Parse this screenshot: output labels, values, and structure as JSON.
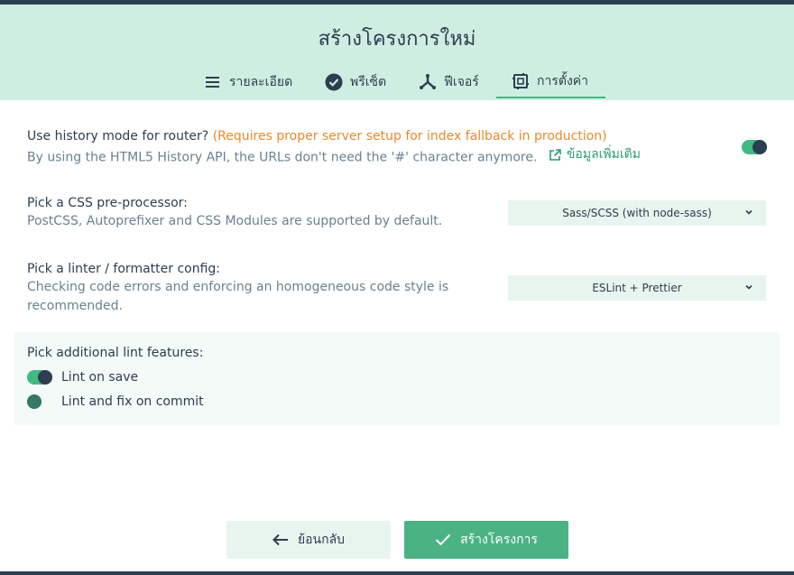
{
  "header": {
    "title": "สร้างโครงการใหม่"
  },
  "tabs": [
    {
      "label": "รายละเอียด",
      "icon": "list-icon"
    },
    {
      "label": "พรีเซ็ต",
      "icon": "check-circle-icon"
    },
    {
      "label": "ฟีเจอร์",
      "icon": "branch-icon"
    },
    {
      "label": "การตั้งค่า",
      "icon": "settings-chip-icon",
      "active": true
    }
  ],
  "history": {
    "label": "Use history mode for router?",
    "warning": "(Requires proper server setup for index fallback in production)",
    "description": "By using the HTML5 History API, the URLs don't need the '#' character anymore.",
    "more_link": "ข้อมูลเพิ่มเติม",
    "enabled": true
  },
  "css": {
    "label": "Pick a CSS pre-processor:",
    "description": "PostCSS, Autoprefixer and CSS Modules are supported by default.",
    "selected": "Sass/SCSS (with node-sass)"
  },
  "linter": {
    "label": "Pick a linter / formatter config:",
    "description_line1": "Checking code errors and enforcing an homogeneous code style is",
    "description_line2": "recommended.",
    "selected": "ESLint + Prettier"
  },
  "lint_features": {
    "label": "Pick additional lint features:",
    "items": [
      {
        "label": "Lint on save",
        "enabled": true
      },
      {
        "label": "Lint and fix on commit",
        "enabled": false
      }
    ]
  },
  "footer": {
    "back_label": "ย้อนกลับ",
    "create_label": "สร้างโครงการ"
  },
  "colors": {
    "accent": "#42b983",
    "header_bg": "#cfeee2",
    "warning": "#e8892b",
    "text": "#2c3e50"
  }
}
